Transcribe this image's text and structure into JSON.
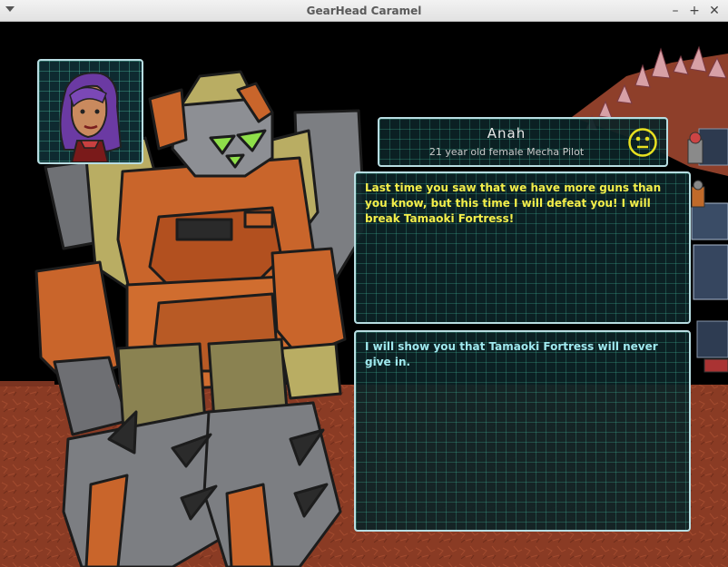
{
  "window": {
    "title": "GearHead Caramel",
    "minimize_glyph": "–",
    "maximize_glyph": "+",
    "close_glyph": "✕"
  },
  "npc": {
    "name": "Anah",
    "description": "21 year old female Mecha Pilot",
    "mood_icon": "neutral-face-icon",
    "mood_color": "#e8e020"
  },
  "conversation": {
    "npc_line": "Last time you saw that we have more guns than you know, but this time I will defeat you! I will break Tamaoki Fortress!",
    "reply_options": [
      "I will show you that Tamaoki Fortress will never give in."
    ]
  },
  "colors": {
    "panel_border": "#b8dde2",
    "panel_grid": "#2f8f7a",
    "npc_text": "#f4ee4a",
    "reply_text": "#9fe8ee",
    "mars_ground": "#8a3b24"
  }
}
